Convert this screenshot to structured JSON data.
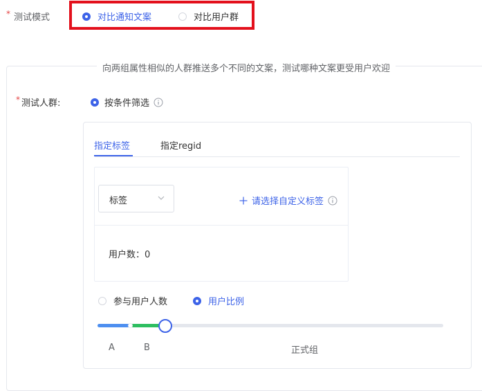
{
  "test_mode": {
    "required_mark": "*",
    "label": "测试模式",
    "options": [
      {
        "label": "对比通知文案",
        "checked": true
      },
      {
        "label": "对比用户群",
        "checked": false
      }
    ]
  },
  "panel": {
    "legend": "向两组属性相似的人群推送多个不同的文案，测试哪种文案更受用户欢迎"
  },
  "audience": {
    "required_mark": "*",
    "label": "测试人群:",
    "option": {
      "label": "按条件筛选",
      "checked": true
    }
  },
  "tabs": [
    {
      "label": "指定标签",
      "active": true
    },
    {
      "label": "指定regid",
      "active": false
    }
  ],
  "tag_filter": {
    "select_value": "标签",
    "add_link": "请选择自定义标签",
    "user_count": "用户数：0"
  },
  "split": {
    "options": [
      {
        "label": "参与用户人数",
        "checked": false
      },
      {
        "label": "用户比例",
        "checked": true
      }
    ],
    "group_labels": [
      "A",
      "B",
      "正式组"
    ],
    "ratio": {
      "A": 0.09,
      "B": 0.1
    },
    "colors": {
      "A": "#4d8ff0",
      "B": "#2dbe60",
      "accent": "#3d63e8"
    }
  }
}
